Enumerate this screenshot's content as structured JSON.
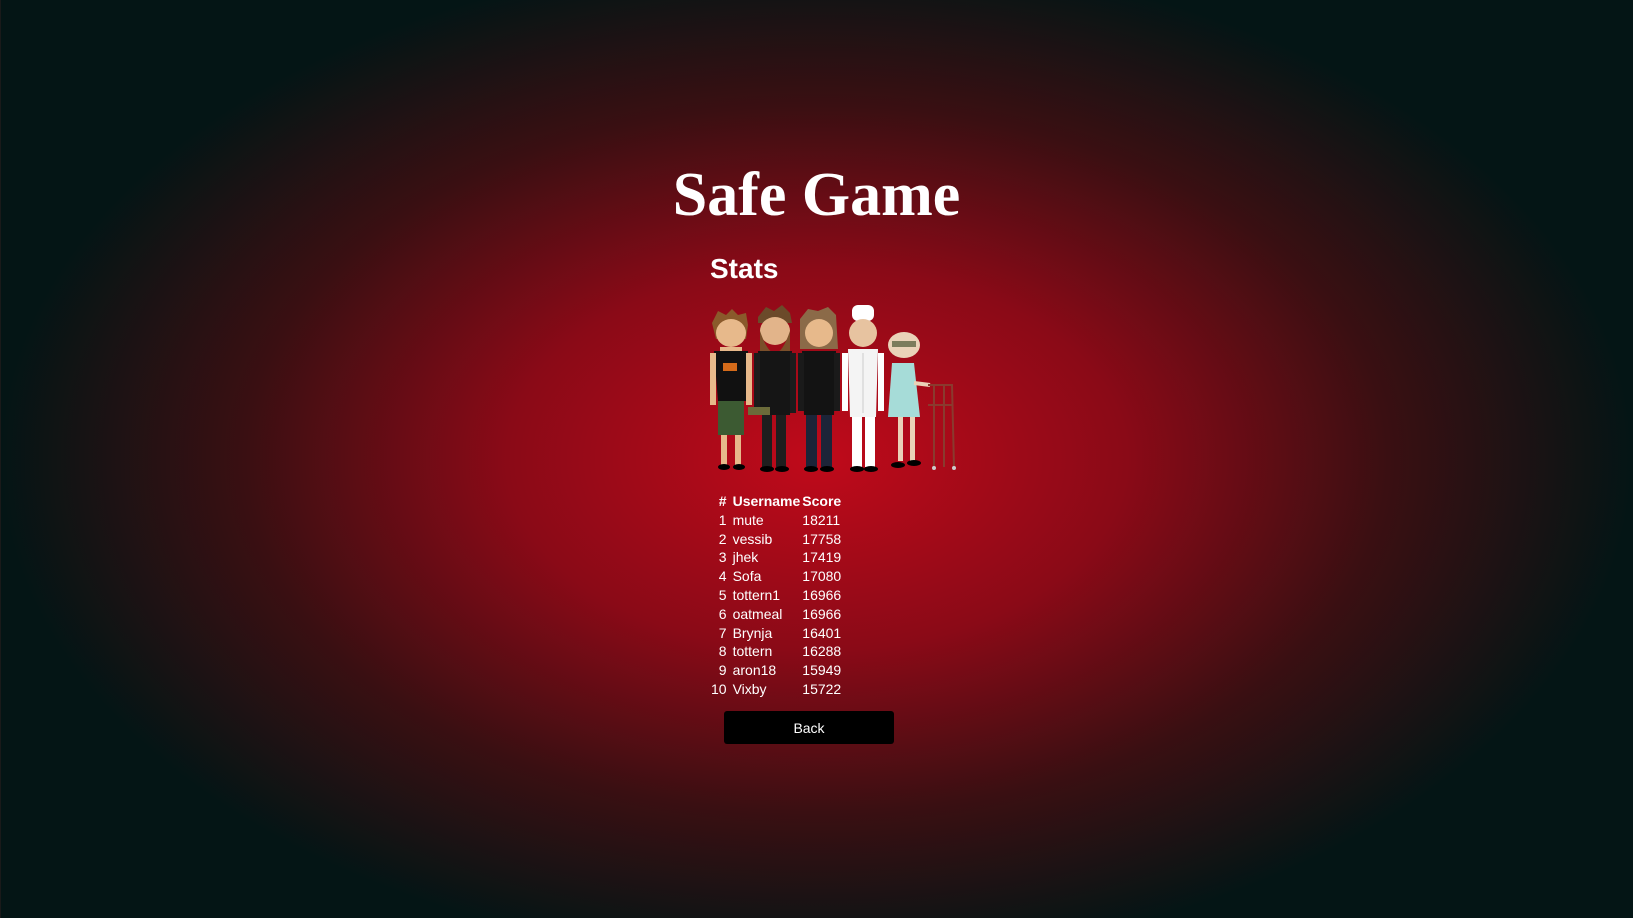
{
  "game": {
    "title": "Safe Game"
  },
  "stats": {
    "heading": "Stats",
    "columns": [
      "#",
      "Username",
      "Score"
    ],
    "rows": [
      {
        "rank": "1",
        "username": "mute",
        "score": "18211"
      },
      {
        "rank": "2",
        "username": "vessib",
        "score": "17758"
      },
      {
        "rank": "3",
        "username": "jhek",
        "score": "17419"
      },
      {
        "rank": "4",
        "username": "Sofa",
        "score": "17080"
      },
      {
        "rank": "5",
        "username": "tottern1",
        "score": "16966"
      },
      {
        "rank": "6",
        "username": "oatmeal",
        "score": "16966"
      },
      {
        "rank": "7",
        "username": "Brynja",
        "score": "16401"
      },
      {
        "rank": "8",
        "username": "tottern",
        "score": "16288"
      },
      {
        "rank": "9",
        "username": "aron18",
        "score": "15949"
      },
      {
        "rank": "10",
        "username": "Vixby",
        "score": "15722"
      }
    ]
  },
  "actions": {
    "back_label": "Back"
  },
  "colors": {
    "background_center": "#c00a1a",
    "background_edge": "#041515",
    "button_bg": "#000000",
    "text": "#ffffff"
  }
}
